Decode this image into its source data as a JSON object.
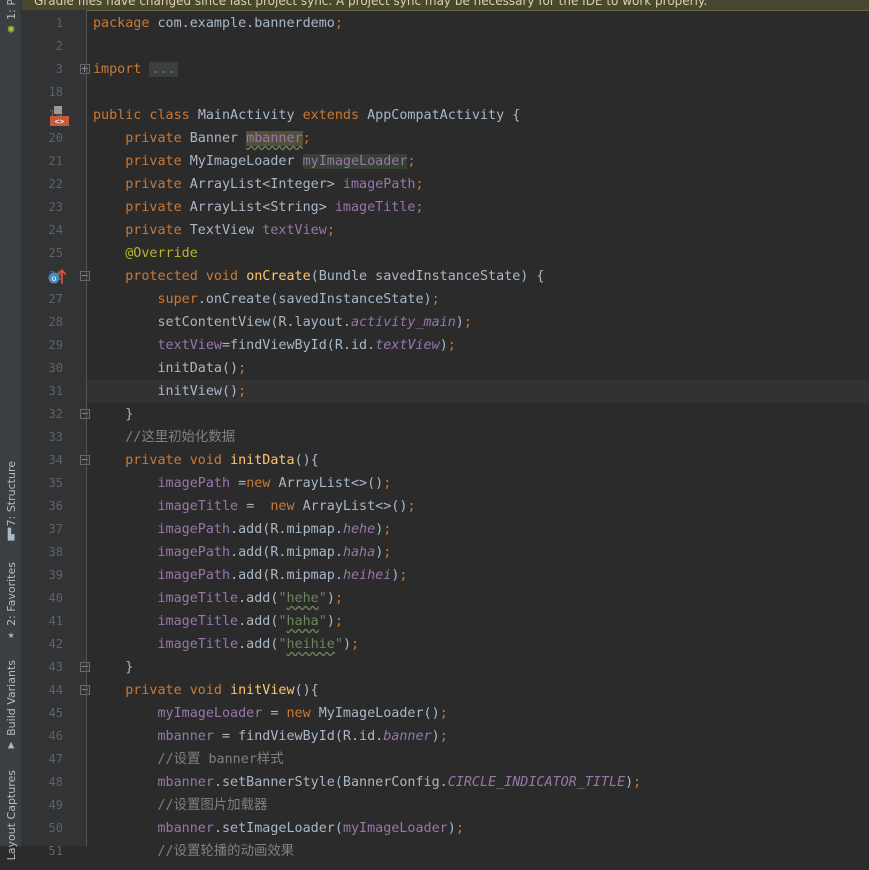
{
  "notification": {
    "text": "Gradle files have changed since last project sync. A project sync may be necessary for the IDE to work properly."
  },
  "tool_windows": [
    {
      "label": "1: P",
      "icon": "android-icon"
    },
    {
      "label": "7: Structure",
      "icon": "structure-icon"
    },
    {
      "label": "2: Favorites",
      "icon": "star-icon"
    },
    {
      "label": "Build Variants",
      "icon": "build-variants-icon"
    },
    {
      "label": "Layout Captures",
      "icon": "captures-icon"
    }
  ],
  "editor": {
    "current_line": 31,
    "lines": [
      {
        "n": "1",
        "tokens": [
          [
            "kw",
            "package "
          ],
          [
            "",
            "com.example.bannerdemo"
          ],
          [
            "kw",
            ";"
          ]
        ]
      },
      {
        "n": "2",
        "tokens": []
      },
      {
        "n": "3",
        "tokens": [
          [
            "kw",
            "import "
          ],
          [
            "importbox",
            "..."
          ]
        ],
        "fold": "plus"
      },
      {
        "n": "18",
        "tokens": []
      },
      {
        "n": "19",
        "tokens": [
          [
            "kw",
            "public class "
          ],
          [
            "",
            "MainActivity "
          ],
          [
            "kw",
            "extends "
          ],
          [
            "",
            "AppCompatActivity {"
          ]
        ],
        "gutter_icon": "layout-icon"
      },
      {
        "n": "20",
        "tokens": [
          [
            "",
            "    "
          ],
          [
            "kw",
            "private "
          ],
          [
            "",
            "Banner "
          ],
          [
            "fld hl2 wavy",
            "mbanner"
          ],
          [
            "kw",
            ";"
          ]
        ]
      },
      {
        "n": "21",
        "tokens": [
          [
            "",
            "    "
          ],
          [
            "kw",
            "private "
          ],
          [
            "",
            "MyImageLoader "
          ],
          [
            "fld hl",
            "myImageLoader"
          ],
          [
            "kw",
            ";"
          ]
        ]
      },
      {
        "n": "22",
        "tokens": [
          [
            "",
            "    "
          ],
          [
            "kw",
            "private "
          ],
          [
            "",
            "ArrayList<Integer> "
          ],
          [
            "fld",
            "imagePath"
          ],
          [
            "kw",
            ";"
          ]
        ]
      },
      {
        "n": "23",
        "tokens": [
          [
            "",
            "    "
          ],
          [
            "kw",
            "private "
          ],
          [
            "",
            "ArrayList<String> "
          ],
          [
            "fld",
            "imageTitle"
          ],
          [
            "kw",
            ";"
          ]
        ]
      },
      {
        "n": "24",
        "tokens": [
          [
            "",
            "    "
          ],
          [
            "kw",
            "private "
          ],
          [
            "",
            "TextView "
          ],
          [
            "fld",
            "textView"
          ],
          [
            "kw",
            ";"
          ]
        ]
      },
      {
        "n": "25",
        "tokens": [
          [
            "",
            "    "
          ],
          [
            "ann",
            "@Override"
          ]
        ]
      },
      {
        "n": "26",
        "tokens": [
          [
            "",
            "    "
          ],
          [
            "kw",
            "protected void "
          ],
          [
            "fn",
            "onCreate"
          ],
          [
            "",
            "(Bundle savedInstanceState) {"
          ]
        ],
        "fold": "minus",
        "gutter_icon": "override-icon"
      },
      {
        "n": "27",
        "tokens": [
          [
            "",
            "        "
          ],
          [
            "kw",
            "super"
          ],
          [
            "",
            ".onCreate(savedInstanceState)"
          ],
          [
            "kw",
            ";"
          ]
        ]
      },
      {
        "n": "28",
        "tokens": [
          [
            "",
            "        setContentView(R.layout."
          ],
          [
            "stat",
            "activity_main"
          ],
          [
            "",
            ")"
          ],
          [
            "kw",
            ";"
          ]
        ]
      },
      {
        "n": "29",
        "tokens": [
          [
            "",
            "        "
          ],
          [
            "fld",
            "textView"
          ],
          [
            "",
            "=findViewById(R.id."
          ],
          [
            "stat",
            "textView"
          ],
          [
            "",
            ")"
          ],
          [
            "kw",
            ";"
          ]
        ]
      },
      {
        "n": "30",
        "tokens": [
          [
            "",
            "        initData()"
          ],
          [
            "kw",
            ";"
          ]
        ]
      },
      {
        "n": "31",
        "tokens": [
          [
            "",
            "        initView()"
          ],
          [
            "kw",
            ";"
          ]
        ]
      },
      {
        "n": "32",
        "tokens": [
          [
            "",
            "    }"
          ]
        ],
        "fold": "minus"
      },
      {
        "n": "33",
        "tokens": [
          [
            "",
            "    "
          ],
          [
            "cmt",
            "//这里初始化数据"
          ]
        ]
      },
      {
        "n": "34",
        "tokens": [
          [
            "",
            "    "
          ],
          [
            "kw",
            "private void "
          ],
          [
            "fn",
            "initData"
          ],
          [
            "",
            "(){"
          ]
        ],
        "fold": "minus"
      },
      {
        "n": "35",
        "tokens": [
          [
            "",
            "        "
          ],
          [
            "fld",
            "imagePath "
          ],
          [
            "",
            "="
          ],
          [
            "kw",
            "new "
          ],
          [
            "",
            "ArrayList<>()"
          ],
          [
            "kw",
            ";"
          ]
        ]
      },
      {
        "n": "36",
        "tokens": [
          [
            "",
            "        "
          ],
          [
            "fld",
            "imageTitle "
          ],
          [
            "",
            "=  "
          ],
          [
            "kw",
            "new "
          ],
          [
            "",
            "ArrayList<>()"
          ],
          [
            "kw",
            ";"
          ]
        ]
      },
      {
        "n": "37",
        "tokens": [
          [
            "",
            "        "
          ],
          [
            "fld",
            "imagePath"
          ],
          [
            "",
            ".add(R.mipmap."
          ],
          [
            "stat",
            "hehe"
          ],
          [
            "",
            ")"
          ],
          [
            "kw",
            ";"
          ]
        ]
      },
      {
        "n": "38",
        "tokens": [
          [
            "",
            "        "
          ],
          [
            "fld",
            "imagePath"
          ],
          [
            "",
            ".add(R.mipmap."
          ],
          [
            "stat",
            "haha"
          ],
          [
            "",
            ")"
          ],
          [
            "kw",
            ";"
          ]
        ]
      },
      {
        "n": "39",
        "tokens": [
          [
            "",
            "        "
          ],
          [
            "fld",
            "imagePath"
          ],
          [
            "",
            ".add(R.mipmap."
          ],
          [
            "stat",
            "heihei"
          ],
          [
            "",
            ")"
          ],
          [
            "kw",
            ";"
          ]
        ]
      },
      {
        "n": "40",
        "tokens": [
          [
            "",
            "        "
          ],
          [
            "fld",
            "imageTitle"
          ],
          [
            "",
            ".add("
          ],
          [
            "str",
            "\""
          ],
          [
            "str wavy",
            "hehe"
          ],
          [
            "str",
            "\""
          ],
          [
            "",
            ")"
          ],
          [
            "kw",
            ";"
          ]
        ]
      },
      {
        "n": "41",
        "tokens": [
          [
            "",
            "        "
          ],
          [
            "fld",
            "imageTitle"
          ],
          [
            "",
            ".add("
          ],
          [
            "str",
            "\""
          ],
          [
            "str wavy",
            "haha"
          ],
          [
            "str",
            "\""
          ],
          [
            "",
            ")"
          ],
          [
            "kw",
            ";"
          ]
        ]
      },
      {
        "n": "42",
        "tokens": [
          [
            "",
            "        "
          ],
          [
            "fld",
            "imageTitle"
          ],
          [
            "",
            ".add("
          ],
          [
            "str",
            "\""
          ],
          [
            "str wavy",
            "heihie"
          ],
          [
            "str",
            "\""
          ],
          [
            "",
            ")"
          ],
          [
            "kw",
            ";"
          ]
        ]
      },
      {
        "n": "43",
        "tokens": [
          [
            "",
            "    }"
          ]
        ],
        "fold": "minus"
      },
      {
        "n": "44",
        "tokens": [
          [
            "",
            "    "
          ],
          [
            "kw",
            "private void "
          ],
          [
            "fn",
            "initView"
          ],
          [
            "",
            "(){"
          ]
        ],
        "fold": "minus"
      },
      {
        "n": "45",
        "tokens": [
          [
            "",
            "        "
          ],
          [
            "fld",
            "myImageLoader "
          ],
          [
            "",
            "= "
          ],
          [
            "kw",
            "new "
          ],
          [
            "",
            "MyImageLoader()"
          ],
          [
            "kw",
            ";"
          ]
        ]
      },
      {
        "n": "46",
        "tokens": [
          [
            "",
            "        "
          ],
          [
            "fld",
            "mbanner "
          ],
          [
            "",
            "= findViewById(R.id."
          ],
          [
            "stat",
            "banner"
          ],
          [
            "",
            ")"
          ],
          [
            "kw",
            ";"
          ]
        ]
      },
      {
        "n": "47",
        "tokens": [
          [
            "",
            "        "
          ],
          [
            "cmt",
            "//设置 banner样式"
          ]
        ]
      },
      {
        "n": "48",
        "tokens": [
          [
            "",
            "        "
          ],
          [
            "fld",
            "mbanner"
          ],
          [
            "",
            ".setBannerStyle(BannerConfig."
          ],
          [
            "stat",
            "CIRCLE_INDICATOR_TITLE"
          ],
          [
            "",
            ")"
          ],
          [
            "kw",
            ";"
          ]
        ]
      },
      {
        "n": "49",
        "tokens": [
          [
            "",
            "        "
          ],
          [
            "cmt",
            "//设置图片加载器"
          ]
        ]
      },
      {
        "n": "50",
        "tokens": [
          [
            "",
            "        "
          ],
          [
            "fld",
            "mbanner"
          ],
          [
            "",
            ".setImageLoader("
          ],
          [
            "fld",
            "myImageLoader"
          ],
          [
            "",
            ")"
          ],
          [
            "kw",
            ";"
          ]
        ]
      },
      {
        "n": "51",
        "tokens": [
          [
            "",
            "        "
          ],
          [
            "cmt",
            "//设置轮播的动画效果"
          ]
        ]
      }
    ]
  }
}
